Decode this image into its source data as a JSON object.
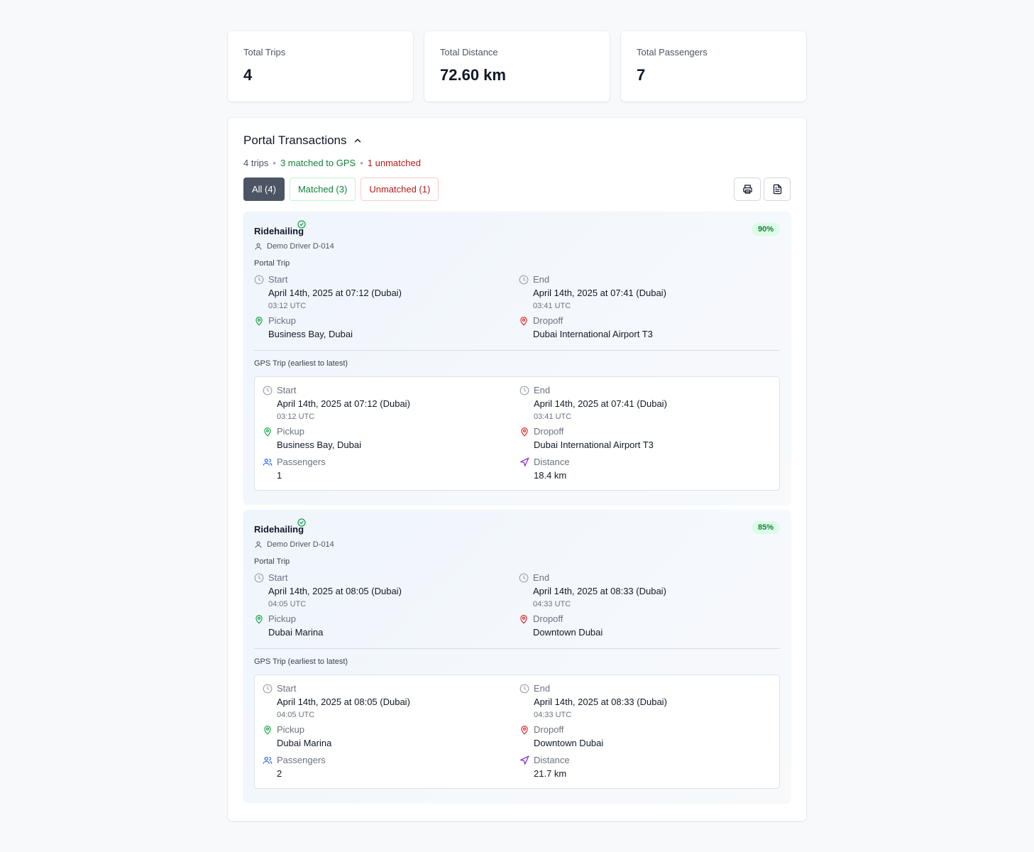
{
  "stats": [
    {
      "label": "Total Trips",
      "value": "4"
    },
    {
      "label": "Total Distance",
      "value": "72.60 km"
    },
    {
      "label": "Total Passengers",
      "value": "7"
    }
  ],
  "panel": {
    "title": "Portal Transactions",
    "summary": {
      "trips": "4 trips",
      "matched": "3 matched to GPS",
      "unmatched": "1 unmatched",
      "separator": "•"
    },
    "filters": {
      "all": "All (4)",
      "matched": "Matched (3)",
      "unmatched": "Unmatched (1)"
    }
  },
  "labels": {
    "portal_trip": "Portal Trip",
    "gps_trip": "GPS Trip (earliest to latest)",
    "start": "Start",
    "end": "End",
    "pickup": "Pickup",
    "dropoff": "Dropoff",
    "passengers": "Passengers",
    "distance": "Distance"
  },
  "trips": [
    {
      "type": "Ridehailing",
      "match": "90%",
      "driver": "Demo Driver D-014",
      "portal": {
        "start": "April 14th, 2025 at 07:12 (Dubai)",
        "start_utc": "03:12 UTC",
        "end": "April 14th, 2025 at 07:41 (Dubai)",
        "end_utc": "03:41 UTC",
        "pickup": "Business Bay, Dubai",
        "dropoff": "Dubai International Airport T3"
      },
      "gps": {
        "start": "April 14th, 2025 at 07:12 (Dubai)",
        "start_utc": "03:12 UTC",
        "end": "April 14th, 2025 at 07:41 (Dubai)",
        "end_utc": "03:41 UTC",
        "pickup": "Business Bay, Dubai",
        "dropoff": "Dubai International Airport T3",
        "passengers": "1",
        "distance": "18.4 km"
      }
    },
    {
      "type": "Ridehailing",
      "match": "85%",
      "driver": "Demo Driver D-014",
      "portal": {
        "start": "April 14th, 2025 at 08:05 (Dubai)",
        "start_utc": "04:05 UTC",
        "end": "April 14th, 2025 at 08:33 (Dubai)",
        "end_utc": "04:33 UTC",
        "pickup": "Dubai Marina",
        "dropoff": "Downtown Dubai"
      },
      "gps": {
        "start": "April 14th, 2025 at 08:05 (Dubai)",
        "start_utc": "04:05 UTC",
        "end": "April 14th, 2025 at 08:33 (Dubai)",
        "end_utc": "04:33 UTC",
        "pickup": "Dubai Marina",
        "dropoff": "Downtown Dubai",
        "passengers": "2",
        "distance": "21.7 km"
      }
    }
  ],
  "icons": {
    "check": "check-circle-icon",
    "user": "user-icon",
    "clock": "clock-icon",
    "pin": "map-pin-icon",
    "users": "users-icon",
    "navigation": "navigation-icon",
    "print": "printer-icon",
    "export": "file-text-icon",
    "collapse": "chevron-up-icon"
  },
  "colors": {
    "green": "#15803d",
    "red": "#b91c1c",
    "purple": "#7e22ce",
    "blue": "#2563eb",
    "active_filter": "#4b5563"
  }
}
